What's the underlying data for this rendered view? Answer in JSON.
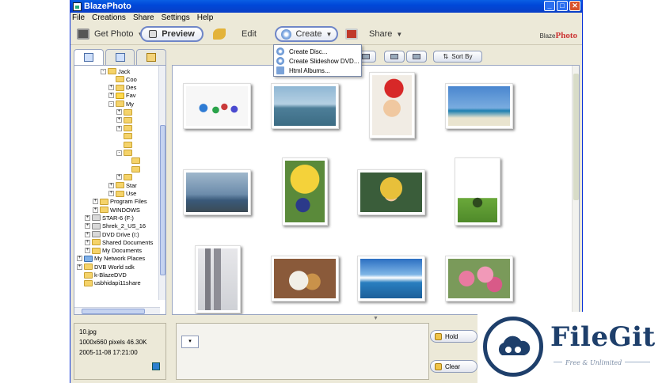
{
  "window": {
    "title": "BlazePhoto",
    "minimize": "_",
    "maximize": "□",
    "close": "✕"
  },
  "menu": [
    "File",
    "Creations",
    "Share",
    "Settings",
    "Help"
  ],
  "toolbar": {
    "get_photo": "Get Photo",
    "preview": "Preview",
    "edit": "Edit",
    "create": "Create",
    "share": "Share",
    "brand_small": "Blaze",
    "brand_big": "Photo"
  },
  "create_menu": [
    "Create Disc...",
    "Create Slideshow DVD...",
    "Html Albums..."
  ],
  "view": {
    "sort_by": "Sort By"
  },
  "tree": [
    {
      "label": "Jack",
      "pm": "-",
      "indent": 3,
      "icon": "folder"
    },
    {
      "label": "Coo",
      "pm": "",
      "indent": 4,
      "icon": "folder"
    },
    {
      "label": "Des",
      "pm": "+",
      "indent": 4,
      "icon": "folder"
    },
    {
      "label": "Fav",
      "pm": "+",
      "indent": 4,
      "icon": "star"
    },
    {
      "label": "My",
      "pm": "-",
      "indent": 4,
      "icon": "folder"
    },
    {
      "label": "",
      "pm": "+",
      "indent": 5,
      "icon": "folder"
    },
    {
      "label": "",
      "pm": "+",
      "indent": 5,
      "icon": "folder"
    },
    {
      "label": "",
      "pm": "+",
      "indent": 5,
      "icon": "folder"
    },
    {
      "label": "",
      "pm": "",
      "indent": 5,
      "icon": "folder"
    },
    {
      "label": "",
      "pm": "",
      "indent": 5,
      "icon": "folder"
    },
    {
      "label": "",
      "pm": "-",
      "indent": 5,
      "icon": "folder"
    },
    {
      "label": "",
      "pm": "",
      "indent": 6,
      "icon": "folder"
    },
    {
      "label": "",
      "pm": "",
      "indent": 6,
      "icon": "folder"
    },
    {
      "label": "",
      "pm": "+",
      "indent": 5,
      "icon": "folder"
    },
    {
      "label": "Star",
      "pm": "+",
      "indent": 4,
      "icon": "folder"
    },
    {
      "label": "Use",
      "pm": "+",
      "indent": 4,
      "icon": "folder"
    },
    {
      "label": "Program Files",
      "pm": "+",
      "indent": 2,
      "icon": "folder"
    },
    {
      "label": "WINDOWS",
      "pm": "+",
      "indent": 2,
      "icon": "folder"
    },
    {
      "label": "STAR-6 (F:)",
      "pm": "+",
      "indent": 1,
      "icon": "drive"
    },
    {
      "label": "Shrek_2_US_16",
      "pm": "+",
      "indent": 1,
      "icon": "drive"
    },
    {
      "label": "DVD Drive (I:)",
      "pm": "+",
      "indent": 1,
      "icon": "drive"
    },
    {
      "label": "Shared Documents",
      "pm": "+",
      "indent": 1,
      "icon": "folder"
    },
    {
      "label": "My Documents",
      "pm": "+",
      "indent": 1,
      "icon": "folder"
    },
    {
      "label": "My Network Places",
      "pm": "+",
      "indent": 0,
      "icon": "net"
    },
    {
      "label": "DVB World sdk",
      "pm": "+",
      "indent": 0,
      "icon": "folder"
    },
    {
      "label": "k-BlazeDVD",
      "pm": "",
      "indent": 0,
      "icon": "folder"
    },
    {
      "label": "usbhidapi11share",
      "pm": "",
      "indent": 0,
      "icon": "folder"
    }
  ],
  "info": {
    "filename": "10.jpg",
    "dimensions": "1000x660 pixels  46.30K",
    "datetime": "2005-11-08 17:21:00"
  },
  "tray": {
    "hold": "Hold",
    "clear": "Clear"
  },
  "watermark": {
    "name": "FileGit",
    "tagline": "Free & Unlimited"
  }
}
